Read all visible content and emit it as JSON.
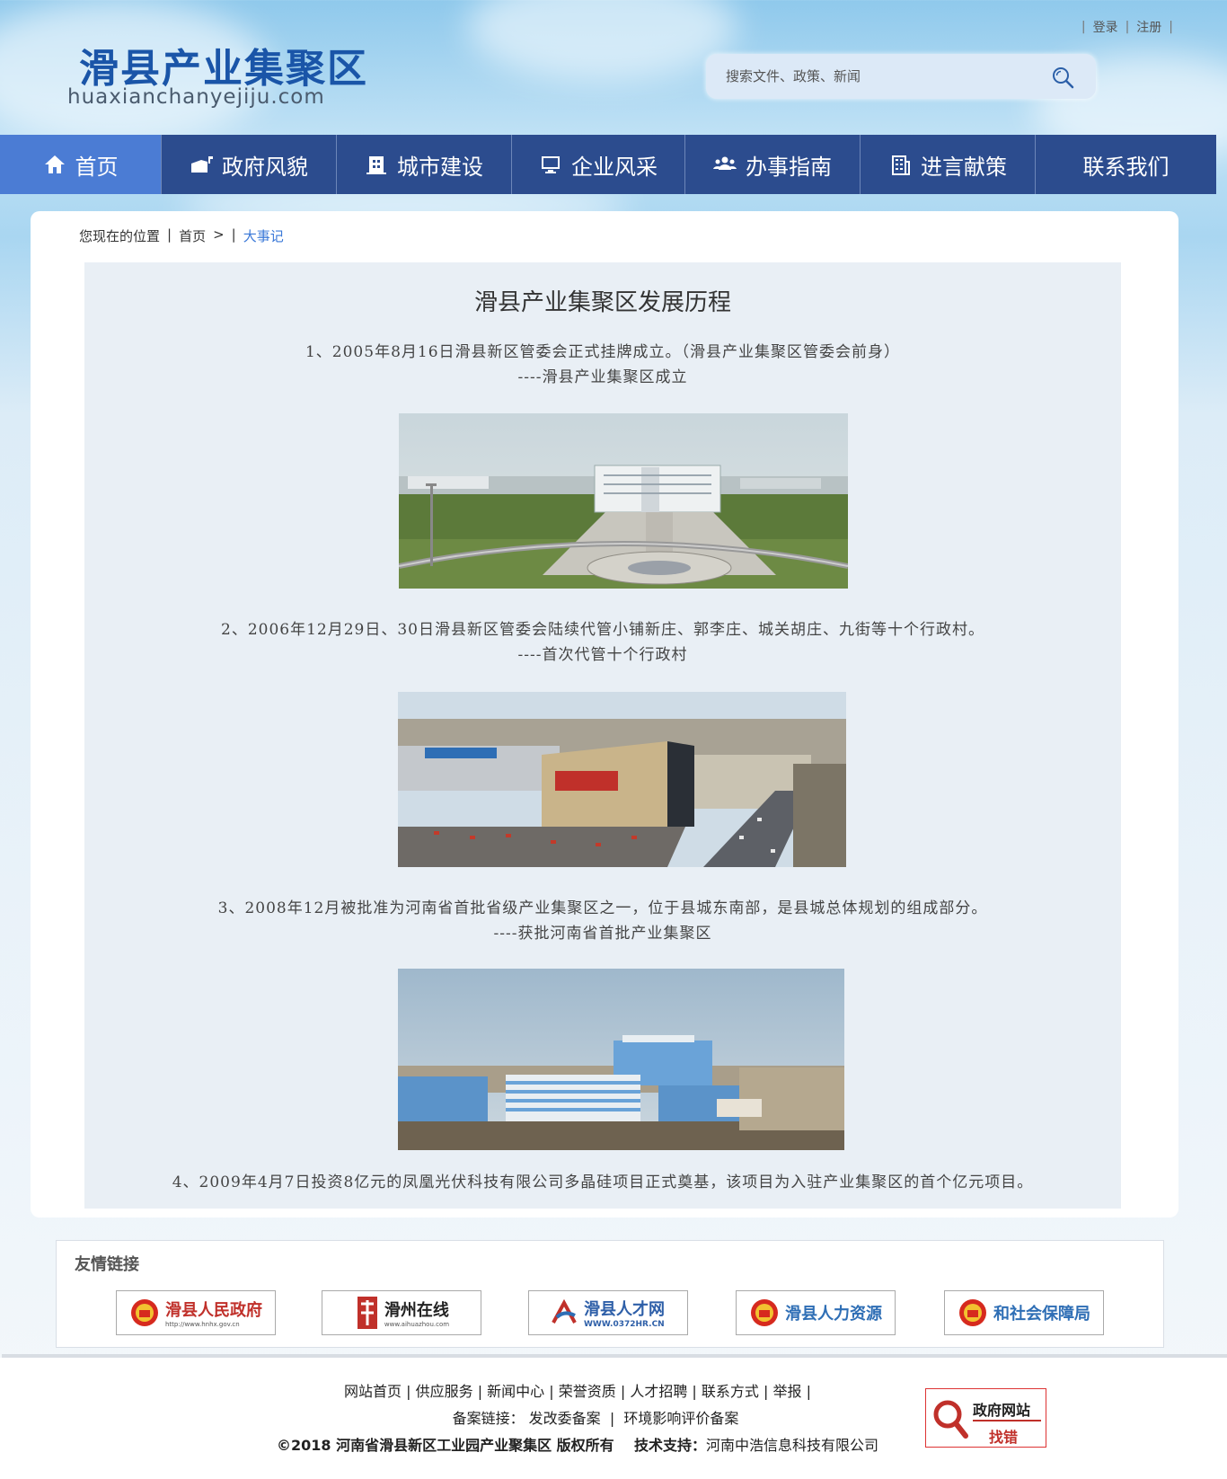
{
  "site": {
    "logo_cn": "滑县产业集聚区",
    "logo_en": "huaxianchanyejiju.com"
  },
  "top_links": {
    "login": "登录",
    "register": "注册",
    "sep": "|"
  },
  "search": {
    "placeholder": "搜索文件、政策、新闻"
  },
  "nav": [
    {
      "label": "首页",
      "icon": "home-icon"
    },
    {
      "label": "政府风貌",
      "icon": "government-icon"
    },
    {
      "label": "城市建设",
      "icon": "building-icon"
    },
    {
      "label": "企业风采",
      "icon": "monitor-icon"
    },
    {
      "label": "办事指南",
      "icon": "people-icon"
    },
    {
      "label": "进言献策",
      "icon": "office-tower-icon"
    },
    {
      "label": "联系我们",
      "icon": ""
    }
  ],
  "breadcrumb": {
    "prefix": "您现在的位置",
    "sep1": "|",
    "home": "首页",
    "arrow": ">",
    "sep2": "|",
    "current": "大事记"
  },
  "article": {
    "title": "滑县产业集聚区发展历程",
    "entries": [
      {
        "text": "1、2005年8月16日滑县新区管委会正式挂牌成立。（滑县产业集聚区管委会前身）",
        "sub": "----滑县产业集聚区成立"
      },
      {
        "text": "2、2006年12月29日、30日滑县新区管委会陆续代管小铺新庄、郭李庄、城关胡庄、九街等十个行政村。",
        "sub": "----首次代管十个行政村"
      },
      {
        "text": "3、2008年12月被批准为河南省首批省级产业集聚区之一，位于县城东南部，是县城总体规划的组成部分。",
        "sub": "----获批河南省首批产业集聚区"
      },
      {
        "text": "4、2009年4月7日投资8亿元的凤凰光伏科技有限公司多晶硅项目正式奠基，该项目为入驻产业集聚区的首个亿元项目。",
        "sub": ""
      }
    ]
  },
  "friendly_links": {
    "title": "友情链接",
    "items": [
      {
        "name": "滑县人民政府",
        "url_text": "http://www.hnhx.gov.cn",
        "icon": "national-emblem-icon"
      },
      {
        "name": "滑州在线",
        "url_text": "www.aihuazhou.com",
        "icon": "city-logo-icon"
      },
      {
        "name": "滑县人才网",
        "url_text": "WWW.0372HR.CN",
        "icon": "talent-logo-icon"
      },
      {
        "name": "滑县人力资源",
        "url_text": "",
        "icon": "national-emblem-icon"
      },
      {
        "name": "和社会保障局",
        "url_text": "",
        "icon": "national-emblem-icon"
      }
    ]
  },
  "footer": {
    "links": [
      "网站首页",
      "供应服务",
      "新闻中心",
      "荣誉资质",
      "人才招聘",
      "联系方式",
      "举报"
    ],
    "beian_label": "备案链接：",
    "beian_items": [
      "发改委备案",
      "环境影响评价备案"
    ],
    "copyright": "©2018 河南省滑县新区工业园产业聚集区 版权所有",
    "tech_label": "技术支持：",
    "tech_company": "河南中浩信息科技有限公司",
    "gov_badge_line1": "政府网站",
    "gov_badge_line2": "找错"
  },
  "colors": {
    "nav_bg": "#2c4c8e",
    "nav_active": "#4b7cd4",
    "logo": "#1a55a8",
    "breadcrumb_current": "#3a78d8"
  }
}
